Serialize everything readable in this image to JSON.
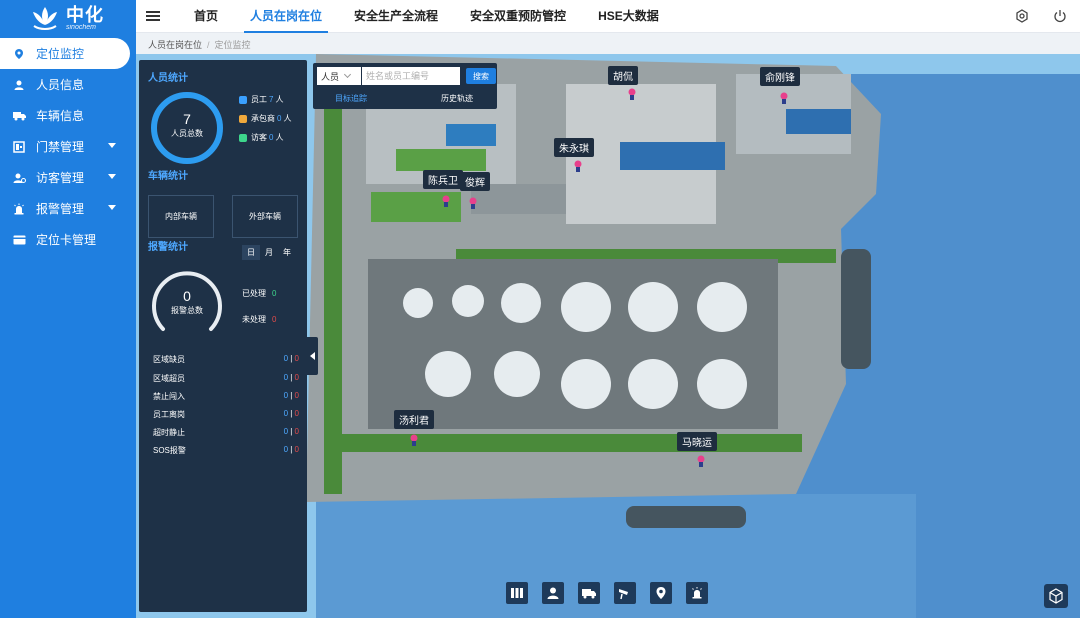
{
  "brand": {
    "name": "中化",
    "subtitle": "sinochem"
  },
  "sidebar": {
    "items": [
      {
        "label": "定位监控",
        "icon": "location-icon",
        "active": true
      },
      {
        "label": "人员信息",
        "icon": "person-icon"
      },
      {
        "label": "车辆信息",
        "icon": "truck-icon"
      },
      {
        "label": "门禁管理",
        "icon": "gate-icon",
        "expandable": true
      },
      {
        "label": "访客管理",
        "icon": "visitor-icon",
        "expandable": true
      },
      {
        "label": "报警管理",
        "icon": "alarm-icon",
        "expandable": true
      },
      {
        "label": "定位卡管理",
        "icon": "card-icon"
      }
    ]
  },
  "header": {
    "tabs": [
      {
        "label": "首页"
      },
      {
        "label": "人员在岗在位",
        "active": true
      },
      {
        "label": "安全生产全流程"
      },
      {
        "label": "安全双重预防管控"
      },
      {
        "label": "HSE大数据"
      }
    ],
    "icons": [
      "settings-icon",
      "power-icon"
    ]
  },
  "breadcrumb": {
    "parent": "人员在岗在位",
    "current": "定位监控"
  },
  "stats": {
    "personnel": {
      "title": "人员统计",
      "total": "7",
      "total_label": "人员总数",
      "legend": [
        {
          "label": "员工",
          "value": "7",
          "unit": "人",
          "color": "#3aa0ff"
        },
        {
          "label": "承包商",
          "value": "0",
          "unit": "人",
          "color": "#f0a93c"
        },
        {
          "label": "访客",
          "value": "0",
          "unit": "人",
          "color": "#3dd68c"
        }
      ]
    },
    "vehicle": {
      "title": "车辆统计",
      "internal": "内部车辆",
      "external": "外部车辆"
    },
    "alarm": {
      "title": "报警统计",
      "periods": [
        "日",
        "月",
        "年"
      ],
      "active_period": "日",
      "total": "0",
      "total_label": "报警总数",
      "handled_label": "已处理",
      "handled": "0",
      "unhandled_label": "未处理",
      "unhandled": "0",
      "rows": [
        {
          "label": "区域缺员",
          "a": "0",
          "b": "0"
        },
        {
          "label": "区域超员",
          "a": "0",
          "b": "0"
        },
        {
          "label": "禁止闯入",
          "a": "0",
          "b": "0"
        },
        {
          "label": "员工离岗",
          "a": "0",
          "b": "0"
        },
        {
          "label": "超时静止",
          "a": "0",
          "b": "0"
        },
        {
          "label": "SOS报警",
          "a": "0",
          "b": "0"
        }
      ]
    }
  },
  "search": {
    "type": "人员",
    "placeholder": "姓名或员工编号",
    "button": "搜索",
    "tabs": [
      "目标追踪",
      "历史轨迹"
    ]
  },
  "map": {
    "people": [
      "胡侃",
      "俞刚锋",
      "朱永琪",
      "陈兵卫",
      "俊辉",
      "汤利君",
      "马晓运"
    ]
  },
  "toolbar": {
    "icons": [
      "layers-icon",
      "person-icon",
      "truck-icon",
      "camera-icon",
      "location-icon",
      "alarm-icon"
    ],
    "corner_icon": "cube-icon"
  }
}
